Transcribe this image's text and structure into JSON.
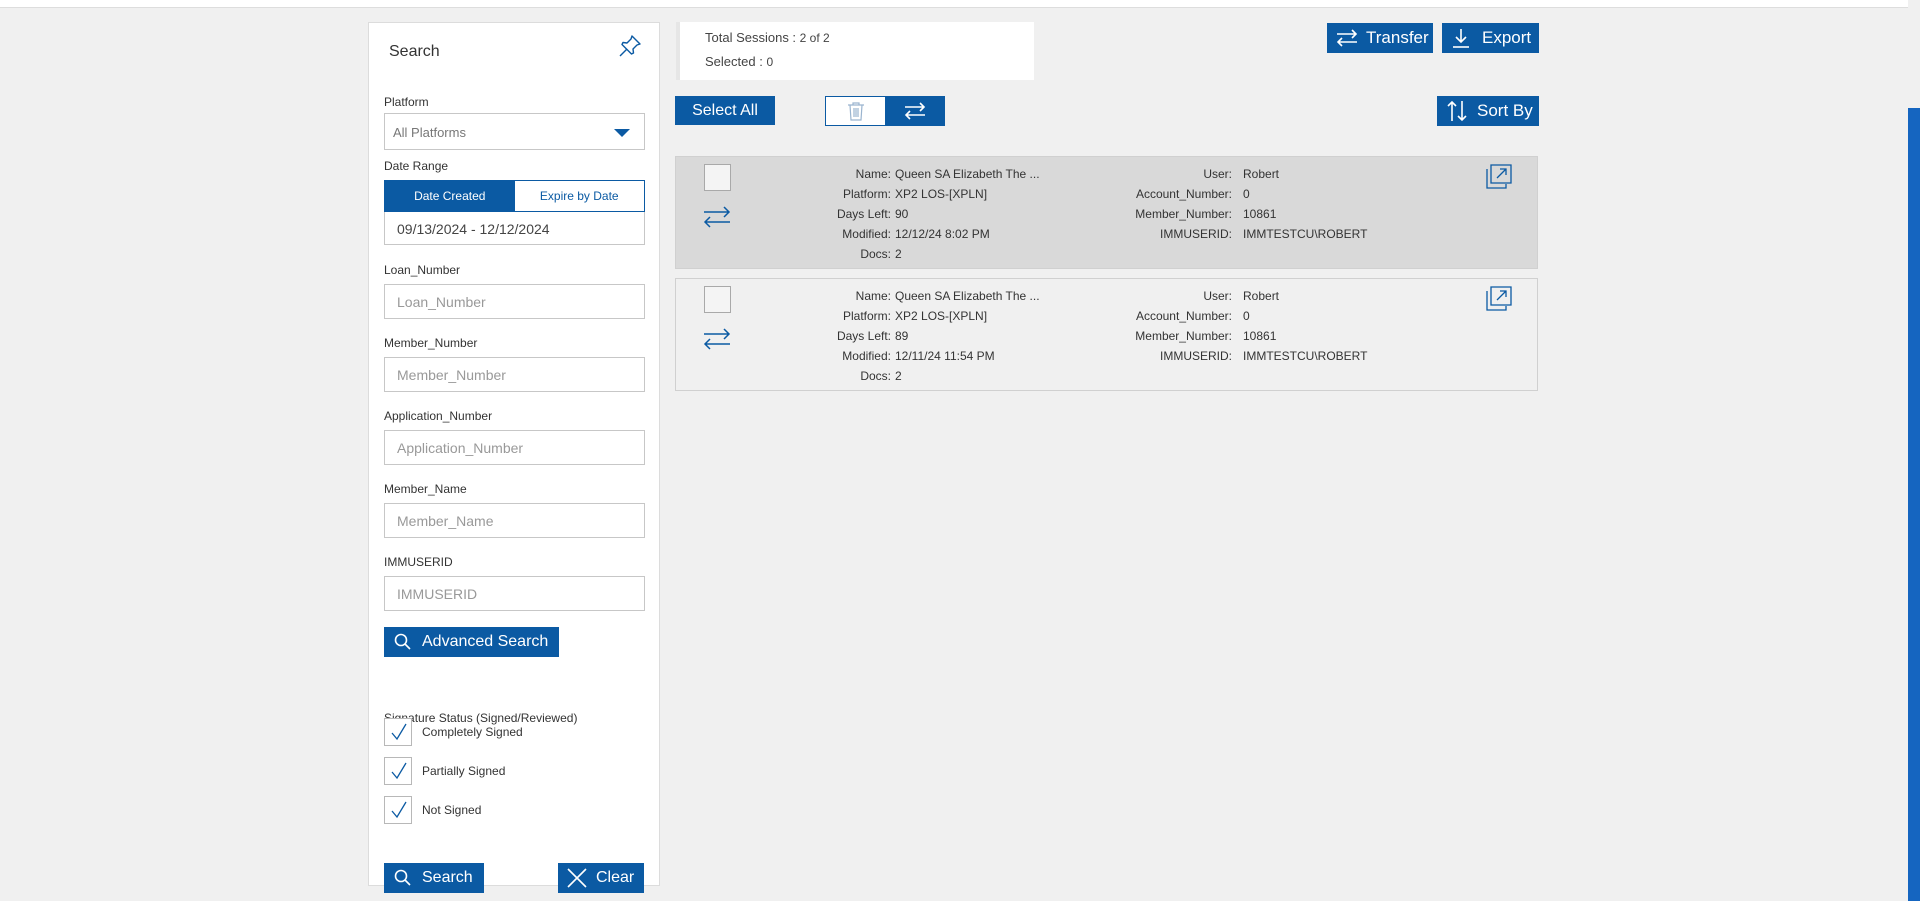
{
  "search": {
    "title": "Search",
    "platform_label": "Platform",
    "platform_value": "All Platforms",
    "date_range_label": "Date Range",
    "date_tabs": [
      "Date Created",
      "Expire by Date"
    ],
    "date_value": "09/13/2024 - 12/12/2024",
    "fields": [
      {
        "label": "Loan_Number",
        "placeholder": "Loan_Number"
      },
      {
        "label": "Member_Number",
        "placeholder": "Member_Number"
      },
      {
        "label": "Application_Number",
        "placeholder": "Application_Number"
      },
      {
        "label": "Member_Name",
        "placeholder": "Member_Name"
      },
      {
        "label": "IMMUSERID",
        "placeholder": "IMMUSERID"
      }
    ],
    "advanced_search_label": "Advanced Search",
    "signature_status_label": "Signature Status (Signed/Reviewed)",
    "signature_options": [
      "Completely Signed",
      "Partially Signed",
      "Not Signed"
    ],
    "search_button": "Search",
    "clear_button": "Clear"
  },
  "summary": {
    "total_label": "Total Sessions :",
    "total_value": "2 of 2",
    "selected_label": "Selected :",
    "selected_value": "0"
  },
  "toolbar": {
    "transfer": "Transfer",
    "export": "Export",
    "select_all": "Select All",
    "sort_by": "Sort By"
  },
  "colors": {
    "accent": "#0b5aa3",
    "scrollbar": "#1565c0"
  },
  "sessions": [
    {
      "name": "Queen SA Elizabeth The ...",
      "platform": "XP2 LOS-[XPLN]",
      "days_left": "90",
      "modified": "12/12/24 8:02 PM",
      "docs": "2",
      "user": "Robert",
      "account_number": "0",
      "member_number": "10861",
      "immuserid": "IMMTESTCU\\ROBERT"
    },
    {
      "name": "Queen SA Elizabeth The ...",
      "platform": "XP2 LOS-[XPLN]",
      "days_left": "89",
      "modified": "12/11/24 11:54 PM",
      "docs": "2",
      "user": "Robert",
      "account_number": "0",
      "member_number": "10861",
      "immuserid": "IMMTESTCU\\ROBERT"
    }
  ],
  "session_labels": {
    "name": "Name:",
    "platform": "Platform:",
    "days_left": "Days Left:",
    "modified": "Modified:",
    "docs": "Docs:",
    "user": "User:",
    "account_number": "Account_Number:",
    "member_number": "Member_Number:",
    "immuserid": "IMMUSERID:"
  }
}
